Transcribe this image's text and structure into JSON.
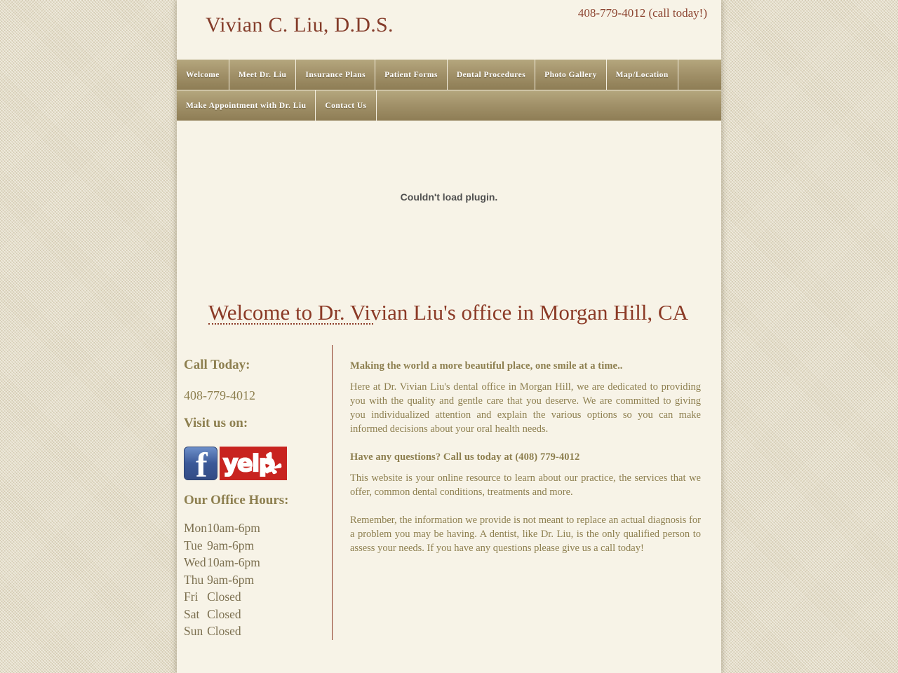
{
  "header": {
    "site_title": "Vivian C. Liu, D.D.S.",
    "phone_note": "408-779-4012 (call today!)"
  },
  "nav": {
    "row1": [
      {
        "label": "Welcome"
      },
      {
        "label": "Meet Dr. Liu"
      },
      {
        "label": "Insurance Plans"
      },
      {
        "label": "Patient Forms"
      },
      {
        "label": "Dental Procedures"
      },
      {
        "label": "Photo Gallery"
      },
      {
        "label": "Map/Location"
      }
    ],
    "row2": [
      {
        "label": "Make Appointment with Dr. Liu"
      },
      {
        "label": "Contact Us"
      }
    ]
  },
  "plugin": {
    "message": "Couldn't load plugin."
  },
  "main": {
    "heading": "Welcome to Dr. Vivian Liu's office in Morgan Hill, CA"
  },
  "sidebar": {
    "call_today_heading": "Call Today:",
    "phone": "408-779-4012",
    "visit_us_heading": "Visit us on:",
    "social": [
      {
        "name": "facebook-logo",
        "label": "f"
      },
      {
        "name": "yelp-logo",
        "label": "yelp"
      }
    ],
    "hours_heading": "Our Office Hours:",
    "hours": [
      {
        "day": "Mon",
        "time": "10am-6pm"
      },
      {
        "day": "Tue",
        "time": "9am-6pm"
      },
      {
        "day": "Wed",
        "time": "10am-6pm"
      },
      {
        "day": "Thu",
        "time": "9am-6pm"
      },
      {
        "day": "Fri",
        "time": "Closed"
      },
      {
        "day": "Sat",
        "time": "Closed"
      },
      {
        "day": "Sun",
        "time": "Closed"
      }
    ]
  },
  "article": {
    "tagline": "Making the world a more beautiful place, one smile at a time..",
    "paragraph1": "Here at Dr. Vivian Liu's dental office in Morgan Hill, we are dedicated to providing you with the quality and gentle care that you deserve. We are committed to giving you individualized attention and explain the various options so you can make informed decisions about your oral health needs.",
    "questions_heading": "Have any questions? Call us today at (408) 779-4012",
    "paragraph2": "This website is your online resource to learn about our practice, the services that we offer, common dental conditions, treatments and more.",
    "paragraph3": "Remember, the information we provide is not meant to replace an actual diagnosis for a problem you may be having. A dentist, like Dr. Liu, is the only qualified person to assess your needs. If you have any questions please give us a call today!"
  },
  "colors": {
    "maroon": "#8b3a26",
    "olive": "#8d7f4f",
    "nav_gold": "#a2926a",
    "page_cream": "#f7f3e7",
    "yelp_red": "#c8231f",
    "facebook_blue": "#3b5998"
  }
}
